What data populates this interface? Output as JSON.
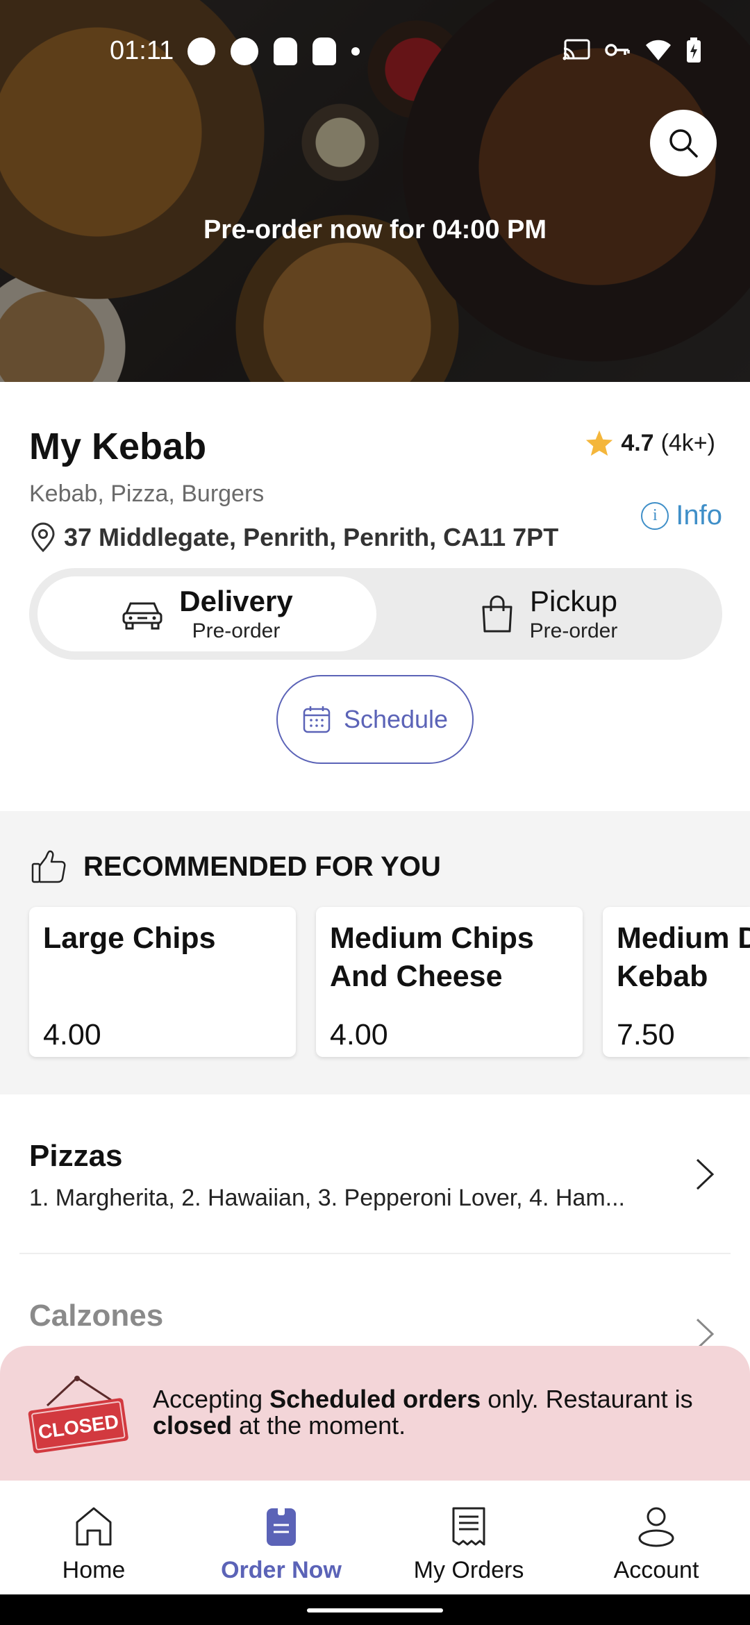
{
  "status_bar": {
    "time": "01:11"
  },
  "hero": {
    "preorder_text": "Pre-order now for 04:00 PM"
  },
  "restaurant": {
    "name": "My Kebab",
    "rating": "4.7",
    "rating_count": "(4k+)",
    "cuisines": "Kebab, Pizza, Burgers",
    "info_label": "Info",
    "address": "37 Middlegate, Penrith, Penrith, CA11 7PT"
  },
  "order_mode": {
    "delivery_label": "Delivery",
    "delivery_sub": "Pre-order",
    "pickup_label": "Pickup",
    "pickup_sub": "Pre-order",
    "selected": "Delivery"
  },
  "schedule": {
    "label": "Schedule"
  },
  "recommended": {
    "title": "RECOMMENDED FOR YOU",
    "items": [
      {
        "name": "Large Chips",
        "price": "4.00"
      },
      {
        "name": "Medium Chips And Cheese",
        "price": "4.00"
      },
      {
        "name": "Medium Doner Kebab",
        "price": "7.50"
      }
    ]
  },
  "categories": [
    {
      "title": "Pizzas",
      "items": "1. Margherita, 2. Hawaiian, 3. Pepperoni Lover, 4. Ham..."
    },
    {
      "title": "Calzones",
      "items": ""
    }
  ],
  "closed_banner": {
    "sign": "CLOSED",
    "text_1": "Accepting ",
    "text_2": "Scheduled orders",
    "text_3": " only. Restaurant is ",
    "text_4": "closed",
    "text_5": " at the moment."
  },
  "bottom_nav": {
    "items": [
      {
        "label": "Home",
        "icon": "home-icon"
      },
      {
        "label": "Order Now",
        "icon": "order-icon"
      },
      {
        "label": "My Orders",
        "icon": "receipt-icon"
      },
      {
        "label": "Account",
        "icon": "user-icon"
      }
    ],
    "active": "Order Now"
  },
  "colors": {
    "accent": "#5b63b7",
    "info": "#3f8fc8",
    "star": "#f4b63b",
    "closed_bg": "#f3d5d8",
    "closed_sign": "#d2393f"
  }
}
